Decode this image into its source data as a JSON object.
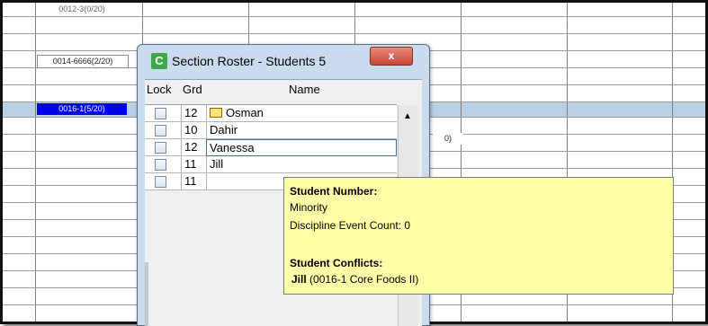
{
  "grid": {
    "chips": {
      "chip1": "0012-3(0/20)",
      "chip2": "0014-6666(2/20)",
      "chip3": "0016-1(5/20)",
      "chip4": "0)"
    }
  },
  "dialog": {
    "title": "Section Roster - Students 5",
    "close_glyph": "x",
    "logo_letter": "C",
    "columns": {
      "lock": "Lock",
      "grade": "Grd",
      "name": "Name"
    },
    "rows": [
      {
        "grade": "12",
        "name": "Osman",
        "has_icon": true
      },
      {
        "grade": "10",
        "name": "Dahir",
        "has_icon": false
      },
      {
        "grade": "12",
        "name": "Vanessa",
        "has_icon": false,
        "selected": true
      },
      {
        "grade": "11",
        "name": "Jill",
        "has_icon": false
      },
      {
        "grade": "11",
        "name": "",
        "has_icon": false
      }
    ],
    "scroll_up_glyph": "▲"
  },
  "tooltip": {
    "student_number_label": "Student Number:",
    "line2": "Minority",
    "line3": "Discipline Event Count: 0",
    "conflicts_label": "Student Conflicts:",
    "conflict_name": "Jill",
    "conflict_detail": " (0016-1 Core Foods II)"
  },
  "colors": {
    "selected_chip": "#0000ee",
    "selection_band": "#b8cfe4",
    "tooltip_bg": "#ffffa8",
    "dialog_frame": "#c9dcee"
  }
}
